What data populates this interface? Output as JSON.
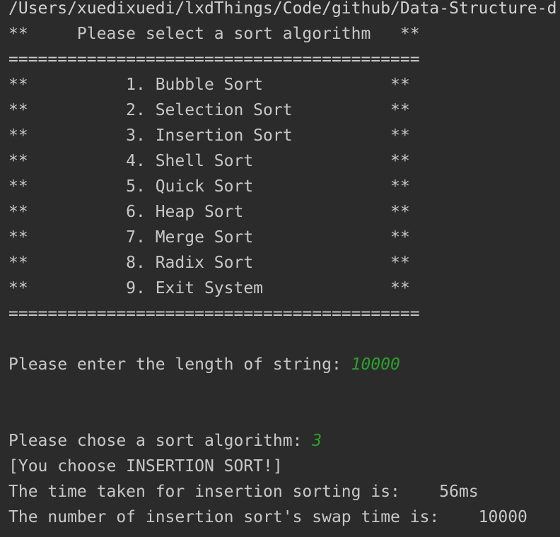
{
  "path_line": "/Users/xuedixuedi/lxdThings/Code/github/Data-Structure-d",
  "menu": {
    "title_line": "**     Please select a sort algorithm   **",
    "separator_top": "==========================================",
    "items": [
      "**          1. Bubble Sort             **",
      "**          2. Selection Sort          **",
      "**          3. Insertion Sort          **",
      "**          4. Shell Sort              **",
      "**          5. Quick Sort              **",
      "**          6. Heap Sort               **",
      "**          7. Merge Sort              **",
      "**          8. Radix Sort              **",
      "**          9. Exit System             **"
    ],
    "separator_bottom": "=========================================="
  },
  "prompt_length": {
    "label": "Please enter the length of string: ",
    "value": "10000"
  },
  "prompt_algorithm": {
    "label": "Please chose a sort algorithm: ",
    "value": "3"
  },
  "result": {
    "choice_msg": "[You choose INSERTION SORT!]",
    "time_line": "The time taken for insertion sorting is:    56ms",
    "swap_line": "The number of insertion sort's swap time is:    10000"
  },
  "colors": {
    "background": "#2b2b2b",
    "text": "#c8c8c8",
    "input": "#2aa02a"
  }
}
